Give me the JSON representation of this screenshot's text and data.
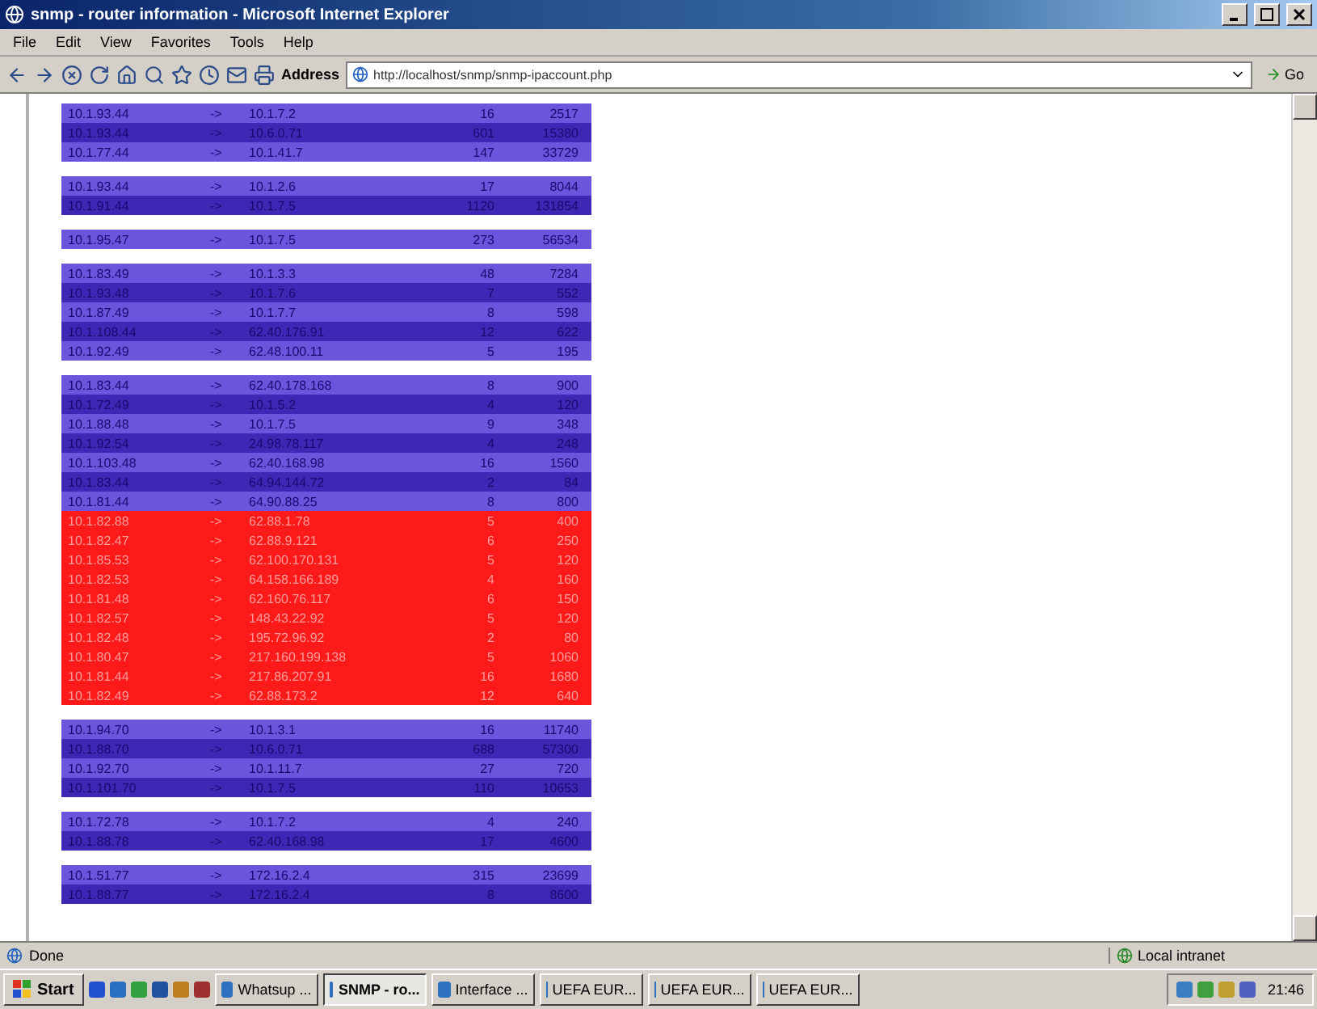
{
  "window": {
    "title": "snmp - router information - Microsoft Internet Explorer"
  },
  "menu": [
    "File",
    "Edit",
    "View",
    "Favorites",
    "Tools",
    "Help"
  ],
  "toolbar": {
    "address_label": "Address",
    "address": "http://localhost/snmp/snmp-ipaccount.php",
    "go": "Go"
  },
  "groups": [
    {
      "rows": [
        {
          "cells": [
            "10.1.93.44",
            "->",
            "10.1.7.2",
            "16",
            "2517"
          ],
          "highlighted": false
        },
        {
          "cells": [
            "10.1.93.44",
            "->",
            "10.6.0.71",
            "601",
            "15380"
          ],
          "highlighted": false
        },
        {
          "cells": [
            "10.1.77.44",
            "->",
            "10.1.41.7",
            "147",
            "33729"
          ],
          "highlighted": false
        }
      ]
    },
    {
      "rows": [
        {
          "cells": [
            "10.1.93.44",
            "->",
            "10.1.2.6",
            "17",
            "8044"
          ],
          "highlighted": false
        },
        {
          "cells": [
            "10.1.91.44",
            "->",
            "10.1.7.5",
            "1120",
            "131854"
          ],
          "highlighted": false
        }
      ]
    },
    {
      "rows": [
        {
          "cells": [
            "10.1.95.47",
            "->",
            "10.1.7.5",
            "273",
            "56534"
          ],
          "highlighted": false
        }
      ]
    },
    {
      "rows": [
        {
          "cells": [
            "10.1.83.49",
            "->",
            "10.1.3.3",
            "48",
            "7284"
          ],
          "highlighted": false
        },
        {
          "cells": [
            "10.1.93.48",
            "->",
            "10.1.7.6",
            "7",
            "552"
          ],
          "highlighted": false
        },
        {
          "cells": [
            "10.1.87.49",
            "->",
            "10.1.7.7",
            "8",
            "598"
          ],
          "highlighted": false
        },
        {
          "cells": [
            "10.1.108.44",
            "->",
            "62.40.176.91",
            "12",
            "622"
          ],
          "highlighted": false
        },
        {
          "cells": [
            "10.1.92.49",
            "->",
            "62.48.100.11",
            "5",
            "195"
          ],
          "highlighted": false
        }
      ]
    },
    {
      "rows": [
        {
          "cells": [
            "10.1.83.44",
            "->",
            "62.40.178.168",
            "8",
            "900"
          ],
          "highlighted": false
        },
        {
          "cells": [
            "10.1.72.49",
            "->",
            "10.1.5.2",
            "4",
            "120"
          ],
          "highlighted": false
        },
        {
          "cells": [
            "10.1.88.48",
            "->",
            "10.1.7.5",
            "9",
            "348"
          ],
          "highlighted": false
        },
        {
          "cells": [
            "10.1.92.54",
            "->",
            "24.98.78.117",
            "4",
            "248"
          ],
          "highlighted": false
        },
        {
          "cells": [
            "10.1.103.48",
            "->",
            "62.40.168.98",
            "16",
            "1560"
          ],
          "highlighted": false
        },
        {
          "cells": [
            "10.1.83.44",
            "->",
            "64.94.144.72",
            "2",
            "84"
          ],
          "highlighted": false
        },
        {
          "cells": [
            "10.1.81.44",
            "->",
            "64.90.88.25",
            "8",
            "800"
          ],
          "highlighted": false
        },
        {
          "cells": [
            "10.1.82.88",
            "->",
            "62.88.1.78",
            "5",
            "400"
          ],
          "highlighted": true
        },
        {
          "cells": [
            "10.1.82.47",
            "->",
            "62.88.9.121",
            "6",
            "250"
          ],
          "highlighted": true
        },
        {
          "cells": [
            "10.1.85.53",
            "->",
            "62.100.170.131",
            "5",
            "120"
          ],
          "highlighted": true
        },
        {
          "cells": [
            "10.1.82.53",
            "->",
            "64.158.166.189",
            "4",
            "160"
          ],
          "highlighted": true
        },
        {
          "cells": [
            "10.1.81.48",
            "->",
            "62.160.76.117",
            "6",
            "150"
          ],
          "highlighted": true
        },
        {
          "cells": [
            "10.1.82.57",
            "->",
            "148.43.22.92",
            "5",
            "120"
          ],
          "highlighted": true
        },
        {
          "cells": [
            "10.1.82.48",
            "->",
            "195.72.96.92",
            "2",
            "80"
          ],
          "highlighted": true
        },
        {
          "cells": [
            "10.1.80.47",
            "->",
            "217.160.199.138",
            "5",
            "1060"
          ],
          "highlighted": true
        },
        {
          "cells": [
            "10.1.81.44",
            "->",
            "217.86.207.91",
            "16",
            "1680"
          ],
          "highlighted": true
        },
        {
          "cells": [
            "10.1.82.49",
            "->",
            "62.88.173.2",
            "12",
            "640"
          ],
          "highlighted": true
        }
      ]
    },
    {
      "rows": [
        {
          "cells": [
            "10.1.94.70",
            "->",
            "10.1.3.1",
            "16",
            "11740"
          ],
          "highlighted": false
        },
        {
          "cells": [
            "10.1.88.70",
            "->",
            "10.6.0.71",
            "688",
            "57300"
          ],
          "highlighted": false
        },
        {
          "cells": [
            "10.1.92.70",
            "->",
            "10.1.11.7",
            "27",
            "720"
          ],
          "highlighted": false
        },
        {
          "cells": [
            "10.1.101.70",
            "->",
            "10.1.7.5",
            "110",
            "10653"
          ],
          "highlighted": false
        }
      ]
    },
    {
      "rows": [
        {
          "cells": [
            "10.1.72.78",
            "->",
            "10.1.7.2",
            "4",
            "240"
          ],
          "highlighted": false
        },
        {
          "cells": [
            "10.1.88.78",
            "->",
            "62.40.168.98",
            "17",
            "4600"
          ],
          "highlighted": false
        }
      ]
    },
    {
      "rows": [
        {
          "cells": [
            "10.1.51.77",
            "->",
            "172.16.2.4",
            "315",
            "23699"
          ],
          "highlighted": false
        },
        {
          "cells": [
            "10.1.88.77",
            "->",
            "172.16.2.4",
            "8",
            "8600"
          ],
          "highlighted": false
        }
      ]
    }
  ],
  "status_bar": {
    "text": "Done",
    "zone": "Local intranet"
  },
  "taskbar": {
    "start": "Start",
    "buttons": [
      {
        "label": "Whatsup ...",
        "selected": false
      },
      {
        "label": "SNMP - ro...",
        "selected": true
      },
      {
        "label": "Interface ...",
        "selected": false
      },
      {
        "label": "UEFA EUR...",
        "selected": false
      },
      {
        "label": "UEFA EUR...",
        "selected": false
      },
      {
        "label": "UEFA EUR...",
        "selected": false
      }
    ],
    "clock": "21:46"
  }
}
